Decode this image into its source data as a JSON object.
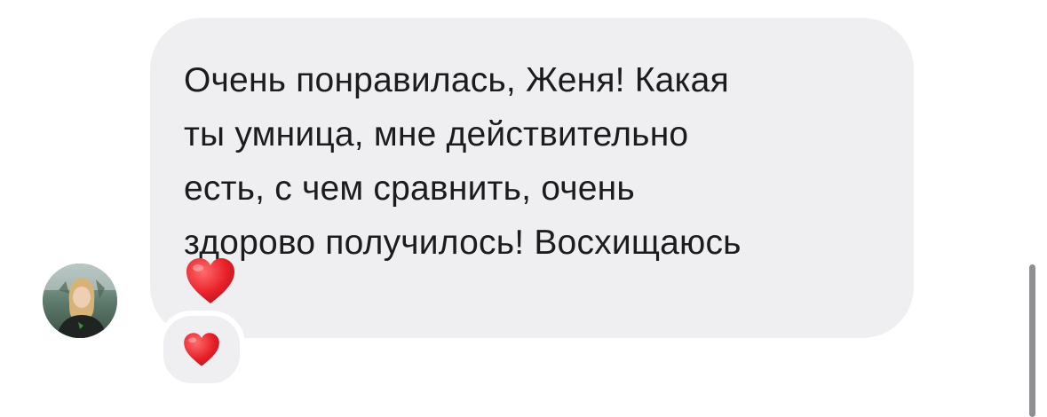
{
  "message": {
    "lines": [
      "Очень понравилась, Женя! Какая",
      "ты умница, мне действительно",
      "есть, с чем сравнить, очень",
      "здорово получилось! Восхищаюсь"
    ],
    "emoji": "red-heart",
    "bubble_color": "#efeff2",
    "text_color": "#1c1c1e"
  },
  "reaction": {
    "emoji": "red-heart",
    "heart_color": "#e8212a"
  },
  "avatar": {
    "icon": "user-photo"
  }
}
